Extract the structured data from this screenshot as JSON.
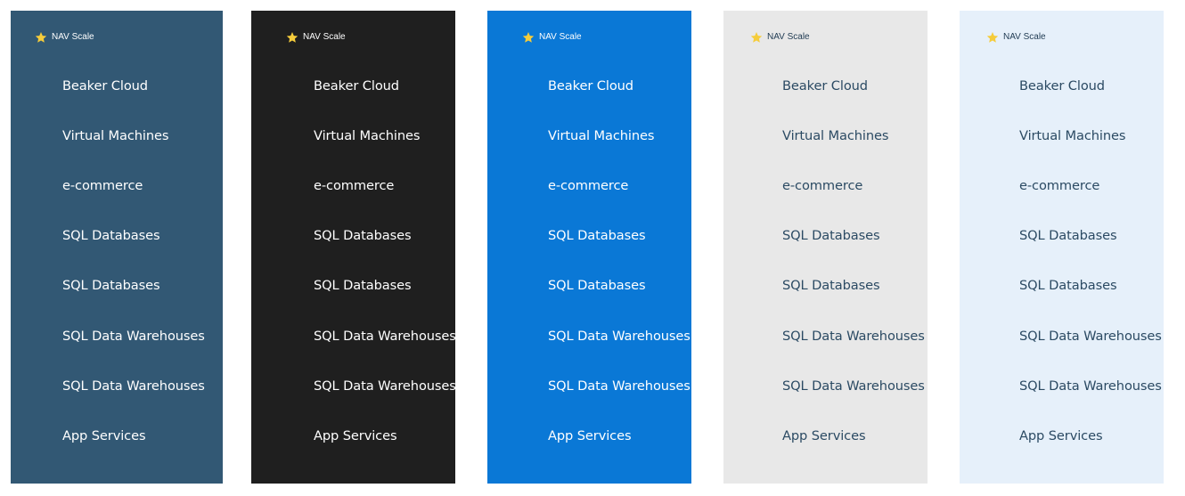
{
  "panels": [
    {
      "theme": "slate",
      "background": "#325874",
      "text_color": "#ffffff",
      "header": {
        "title": "NAV Scale",
        "star_color": "#f5cc3b",
        "title_color": "#ffffff"
      },
      "items": [
        "Beaker Cloud",
        "Virtual Machines",
        "e-commerce",
        "SQL Databases",
        "SQL Databases",
        "SQL Data Warehouses",
        "SQL Data Warehouses",
        "App Services"
      ]
    },
    {
      "theme": "dark",
      "background": "#1f1f1f",
      "text_color": "#ffffff",
      "header": {
        "title": "NAV Scale",
        "star_color": "#f5cc3b",
        "title_color": "#ffffff"
      },
      "items": [
        "Beaker Cloud",
        "Virtual Machines",
        "e-commerce",
        "SQL Databases",
        "SQL Databases",
        "SQL Data Warehouses",
        "SQL Data Warehouses",
        "App Services"
      ]
    },
    {
      "theme": "blue",
      "background": "#0a78d6",
      "text_color": "#ffffff",
      "header": {
        "title": "NAV Scale",
        "star_color": "#f5cc3b",
        "title_color": "#ffffff"
      },
      "items": [
        "Beaker Cloud",
        "Virtual Machines",
        "e-commerce",
        "SQL Databases",
        "SQL Databases",
        "SQL Data Warehouses",
        "SQL Data Warehouses",
        "App Services"
      ]
    },
    {
      "theme": "light-gray",
      "background": "#e8e8e8",
      "text_color": "#2b4a63",
      "header": {
        "title": "NAV Scale",
        "star_color": "#f5cc3b",
        "title_color": "#1f3a52"
      },
      "items": [
        "Beaker Cloud",
        "Virtual Machines",
        "e-commerce",
        "SQL Databases",
        "SQL Databases",
        "SQL Data Warehouses",
        "SQL Data Warehouses",
        "App Services"
      ]
    },
    {
      "theme": "light-blue",
      "background": "#e6f0fa",
      "text_color": "#2b4a63",
      "header": {
        "title": "NAV Scale",
        "star_color": "#f5cc3b",
        "title_color": "#1f3a52"
      },
      "items": [
        "Beaker Cloud",
        "Virtual Machines",
        "e-commerce",
        "SQL Databases",
        "SQL Databases",
        "SQL Data Warehouses",
        "SQL Data Warehouses",
        "App Services"
      ]
    }
  ]
}
